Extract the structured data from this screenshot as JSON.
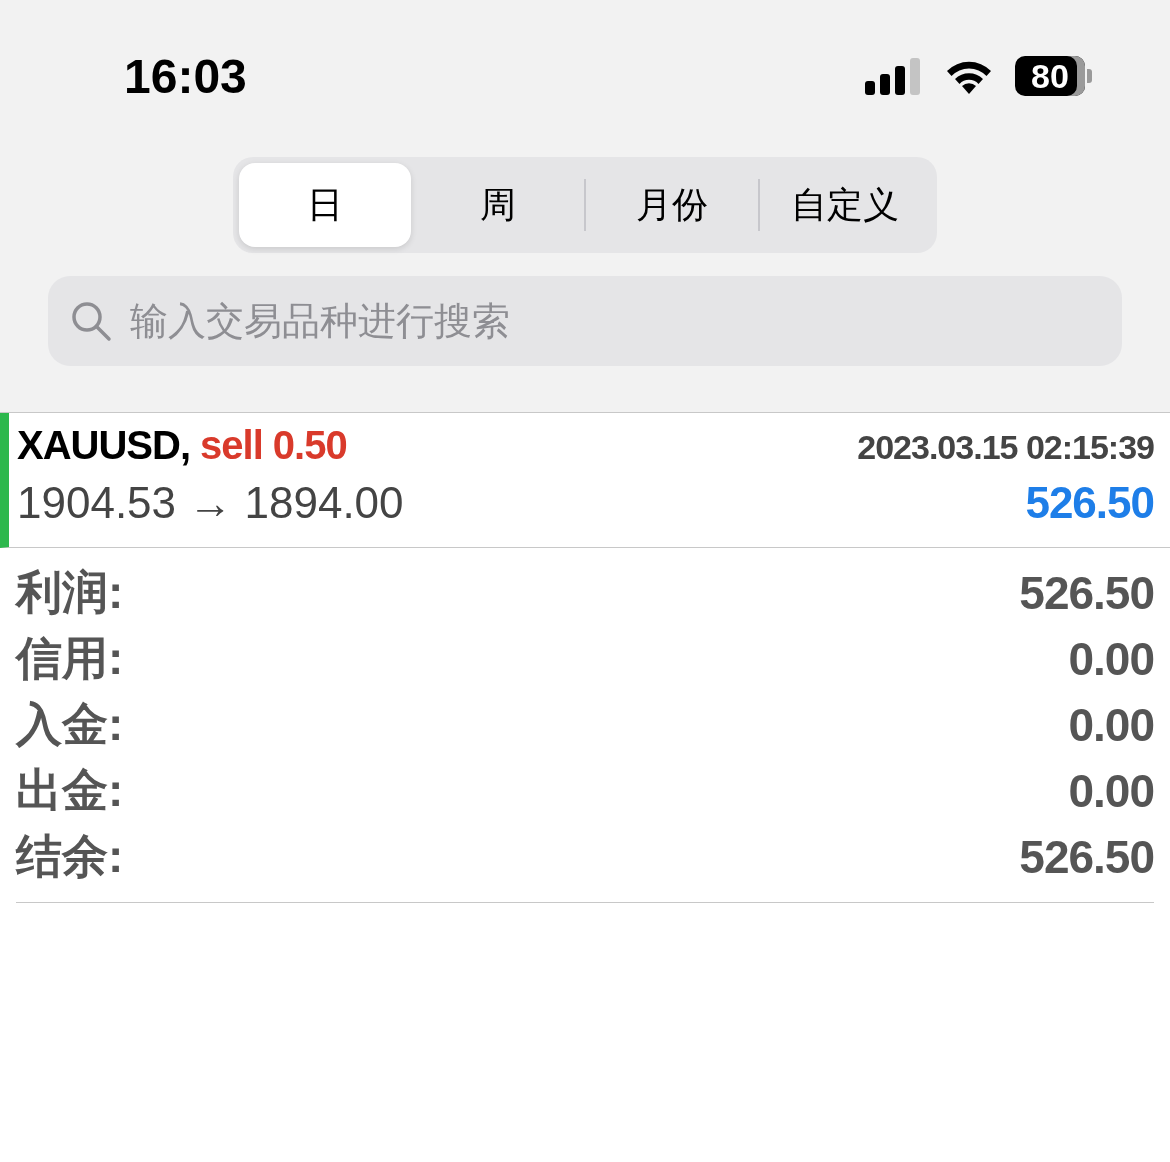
{
  "status_bar": {
    "time": "16:03",
    "battery": "80"
  },
  "tabs": [
    {
      "label": "日",
      "selected": true
    },
    {
      "label": "周",
      "selected": false
    },
    {
      "label": "月份",
      "selected": false
    },
    {
      "label": "自定义",
      "selected": false
    }
  ],
  "search": {
    "placeholder": "输入交易品种进行搜索"
  },
  "trade": {
    "symbol": "XAUUSD,",
    "order": "sell 0.50",
    "time": "2023.03.15 02:15:39",
    "prices": "1904.53 → 1894.00",
    "profit": "526.50"
  },
  "summary": [
    {
      "label": "利润:",
      "value": "526.50"
    },
    {
      "label": "信用:",
      "value": "0.00"
    },
    {
      "label": "入金:",
      "value": "0.00"
    },
    {
      "label": "出金:",
      "value": "0.00"
    },
    {
      "label": "结余:",
      "value": "526.50"
    }
  ]
}
